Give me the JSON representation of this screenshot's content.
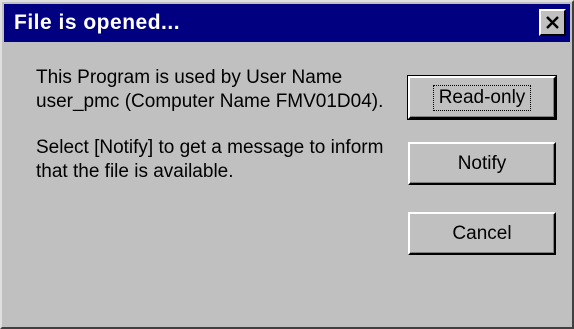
{
  "window": {
    "title": "File is opened...",
    "close_icon": "close-icon"
  },
  "message": {
    "line1": "This Program is used by User Name user_pmc (Computer Name FMV01D04).",
    "line2": "Select [Notify] to get a message to inform that the file is available."
  },
  "buttons": {
    "read_only": "Read-only",
    "notify": "Notify",
    "cancel": "Cancel"
  },
  "colors": {
    "titlebar": "#000080",
    "face": "#c0c0c0"
  }
}
